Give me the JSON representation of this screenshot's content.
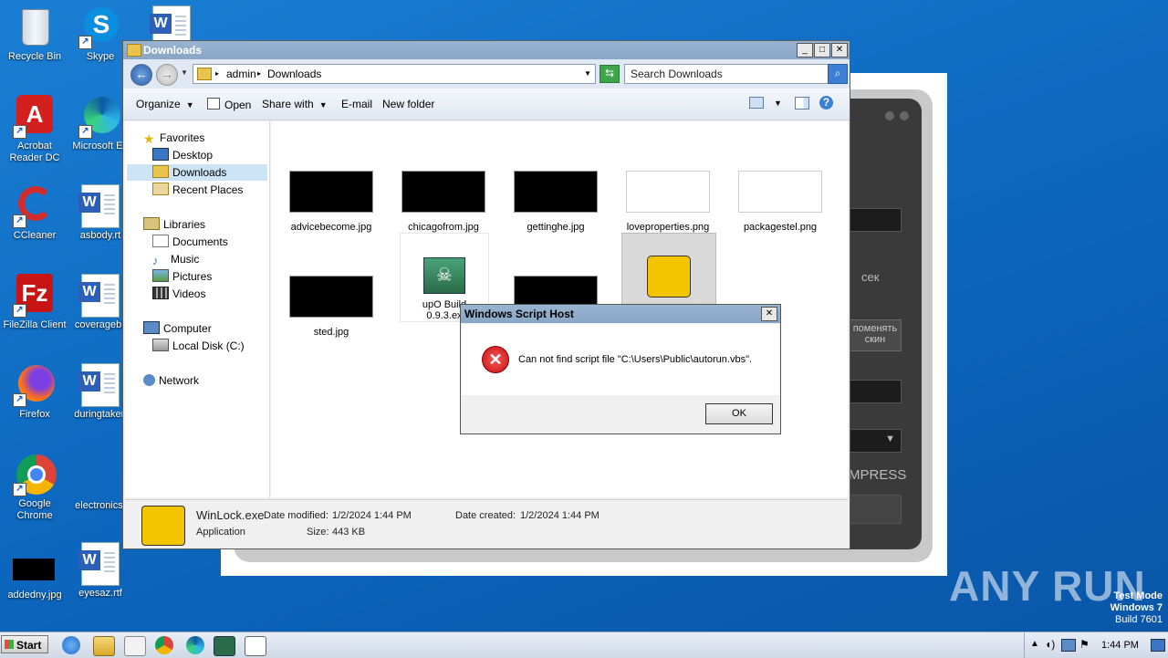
{
  "desktop": {
    "icons": [
      {
        "label": "Recycle Bin"
      },
      {
        "label": "Skype"
      },
      {
        "label": "Acrobat Reader DC"
      },
      {
        "label": "Microsoft Ed"
      },
      {
        "label": "CCleaner"
      },
      {
        "label": "asbody.rt"
      },
      {
        "label": "FileZilla Client"
      },
      {
        "label": "coveragebil"
      },
      {
        "label": "Firefox"
      },
      {
        "label": "duringtaken"
      },
      {
        "label": "Google Chrome"
      },
      {
        "label": "electronics."
      },
      {
        "label": "addedny.jpg"
      },
      {
        "label": "eyesaz.rtf"
      }
    ]
  },
  "background_app": {
    "sec_label": "сек",
    "change_skin": "поменять скин",
    "compress": "MPRESS"
  },
  "explorer": {
    "title": "Downloads",
    "breadcrumb": [
      "admin",
      "Downloads"
    ],
    "search_placeholder": "Search Downloads",
    "toolbar": {
      "organize": "Organize",
      "open": "Open",
      "share_with": "Share with",
      "email": "E-mail",
      "new_folder": "New folder"
    },
    "nav": {
      "favorites": "Favorites",
      "desktop": "Desktop",
      "downloads": "Downloads",
      "recent_places": "Recent Places",
      "libraries": "Libraries",
      "documents": "Documents",
      "music": "Music",
      "pictures": "Pictures",
      "videos": "Videos",
      "computer": "Computer",
      "local_disk": "Local Disk (C:)",
      "network": "Network"
    },
    "files": [
      {
        "name": "advicebecome.jpg"
      },
      {
        "name": "chicagofrom.jpg"
      },
      {
        "name": "gettinghe.jpg"
      },
      {
        "name": "loveproperties.png"
      },
      {
        "name": "packagestel.png"
      },
      {
        "name": "sted.jpg"
      },
      {
        "name": "upO Build 0.9.3.ex"
      }
    ],
    "details": {
      "file_name": "WinLock.exe",
      "date_modified_label": "Date modified:",
      "date_modified": "1/2/2024 1:44 PM",
      "date_created_label": "Date created:",
      "date_created": "1/2/2024 1:44 PM",
      "type": "Application",
      "size_label": "Size:",
      "size": "443 KB"
    }
  },
  "dialog": {
    "title": "Windows Script Host",
    "message": "Can not find script file \"C:\\Users\\Public\\autorun.vbs\".",
    "ok": "OK"
  },
  "watermark": {
    "brand": "ANY RUN",
    "test_mode": "Test Mode",
    "os": "Windows 7",
    "build": "Build 7601"
  },
  "taskbar": {
    "start": "Start",
    "clock": "1:44 PM"
  },
  "colors": {
    "desktop_bg": "#0f6cc3",
    "title_bar": "#99b4d1",
    "selection": "#cde4f7",
    "error_red": "#c01010",
    "winlock_yellow": "#f5c400"
  }
}
